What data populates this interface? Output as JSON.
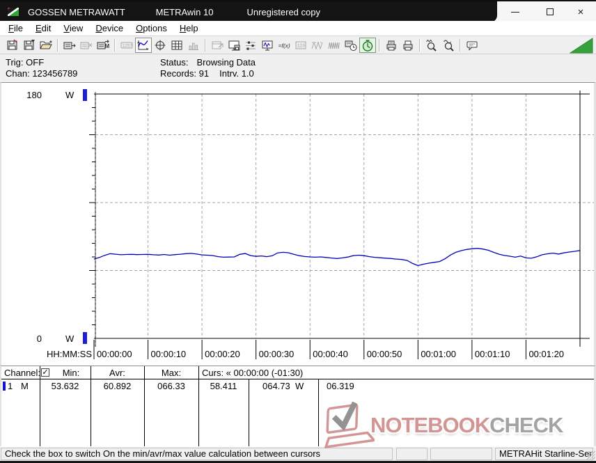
{
  "window": {
    "title_app": "GOSSEN METRAWATT",
    "title_product": "METRAwin 10",
    "title_status": "Unregistered copy",
    "controls": {
      "minimize": "minimize",
      "maximize": "maximize",
      "close": "×"
    }
  },
  "menu": {
    "items": [
      "File",
      "Edit",
      "View",
      "Device",
      "Options",
      "Help"
    ]
  },
  "toolbar": {
    "groups": [
      [
        "save-file-icon",
        "save-as-icon",
        "open-file-icon"
      ],
      [
        "device-read-icon",
        "device-stop-icon",
        "device-memory-icon"
      ],
      [
        "display-values-icon",
        "chart-view-icon",
        "crosshair-view-icon",
        "table-view-icon",
        "bargraph-view-icon"
      ],
      [
        "window-export-icon",
        "export-disk-icon",
        "channel-config-icon",
        "monitor-live-icon",
        "formula-icon",
        "device-values-icon",
        "wave-single-icon",
        "wave-multi-icon",
        "time-sync-icon",
        "timer-icon"
      ],
      [
        "print-form-icon",
        "print-icon"
      ],
      [
        "zoom-in-icon",
        "zoom-out-icon"
      ],
      [
        "annotation-icon"
      ]
    ],
    "disabled": [
      "device-stop-icon",
      "display-values-icon",
      "bargraph-view-icon",
      "window-export-icon",
      "device-values-icon",
      "wave-single-icon",
      "wave-multi-icon"
    ],
    "pressed": [
      "chart-view-icon"
    ],
    "pressed_green": [
      "timer-icon"
    ]
  },
  "status_panel": {
    "trig_label": "Trig:",
    "trig_value": "OFF",
    "chan_label": "Chan:",
    "chan_value": "123456789",
    "status_label": "Status:",
    "status_value": "Browsing Data",
    "records_label": "Records:",
    "records_value": "91",
    "interval_label": "Intrv.",
    "interval_value": "1.0"
  },
  "chart_data": {
    "type": "line",
    "title": "",
    "ylabel_unit": "W",
    "y_top_label": "180",
    "y_bottom_label": "0",
    "ylim": [
      0,
      180
    ],
    "y_major_step": 50,
    "y_minor_step": 10,
    "xlabel": "HH:MM:SS",
    "x_tick_labels": [
      "00:00:00",
      "00:00:10",
      "00:00:20",
      "00:00:30",
      "00:00:40",
      "00:00:50",
      "00:01:00",
      "00:01:10",
      "00:01:20"
    ],
    "x_tick_interval_s": 10,
    "x_range_s": [
      0,
      91.8
    ],
    "grid": "dashed",
    "legend": "none",
    "cursor1_s": 0,
    "cursor2_s": 90,
    "series": [
      {
        "name": "channel-1-power",
        "unit": "W",
        "x_start_s": 0,
        "x_step_s": 1,
        "values": [
          58.4,
          59.6,
          61.2,
          62.4,
          62.0,
          61.6,
          61.8,
          61.9,
          61.7,
          61.8,
          61.9,
          61.6,
          61.4,
          61.8,
          61.3,
          61.7,
          62.0,
          62.4,
          62.6,
          62.1,
          61.5,
          61.3,
          61.0,
          60.2,
          59.8,
          59.9,
          60.0,
          61.9,
          62.5,
          61.0,
          60.4,
          60.7,
          60.2,
          60.8,
          63.0,
          63.4,
          63.1,
          61.9,
          60.9,
          60.3,
          60.0,
          59.8,
          60.0,
          59.6,
          59.2,
          58.8,
          59.3,
          59.9,
          60.9,
          61.3,
          60.9,
          60.2,
          59.7,
          59.4,
          59.1,
          58.8,
          58.4,
          58.1,
          57.4,
          55.2,
          53.6,
          54.6,
          55.4,
          56.0,
          56.6,
          58.6,
          61.4,
          63.4,
          64.6,
          65.5,
          66.0,
          66.3,
          65.8,
          64.9,
          63.4,
          62.0,
          61.1,
          60.5,
          59.8,
          60.6,
          59.3,
          59.0,
          60.1,
          61.6,
          62.3,
          62.8,
          62.1,
          63.0,
          63.6,
          64.1,
          64.7
        ]
      }
    ],
    "line_color": "#0000bb"
  },
  "table": {
    "header": {
      "channel": "Channel:",
      "checkbox_checked": true,
      "check_glyph": "✓",
      "min": "Min:",
      "avr": "Avr:",
      "max": "Max:",
      "cursor": "Curs: « 00:00:00 (-01:30)"
    },
    "row": {
      "channel": "1",
      "flag": "M",
      "min": "53.632",
      "avr": "60.892",
      "max": "066.33",
      "cursor1": "58.411",
      "cursor2": "064.73",
      "cursor2_unit": "W",
      "delta": "06.319"
    }
  },
  "statusbar": {
    "message": "Check the box to switch On the min/avr/max value calculation between cursors",
    "device": "METRAHit Starline-Seri"
  },
  "watermark": {
    "text_primary": "NOTEBOOK",
    "text_secondary": "CHECK"
  },
  "colors": {
    "series_blue": "#0000bb",
    "cursor_handle_blue": "#1f1fd6",
    "toolbar_triangle_green": "#35a13c",
    "watermark_red": "#d08d8c",
    "watermark_gray": "#9c9c9c",
    "titlebar_dark": "#141414"
  }
}
